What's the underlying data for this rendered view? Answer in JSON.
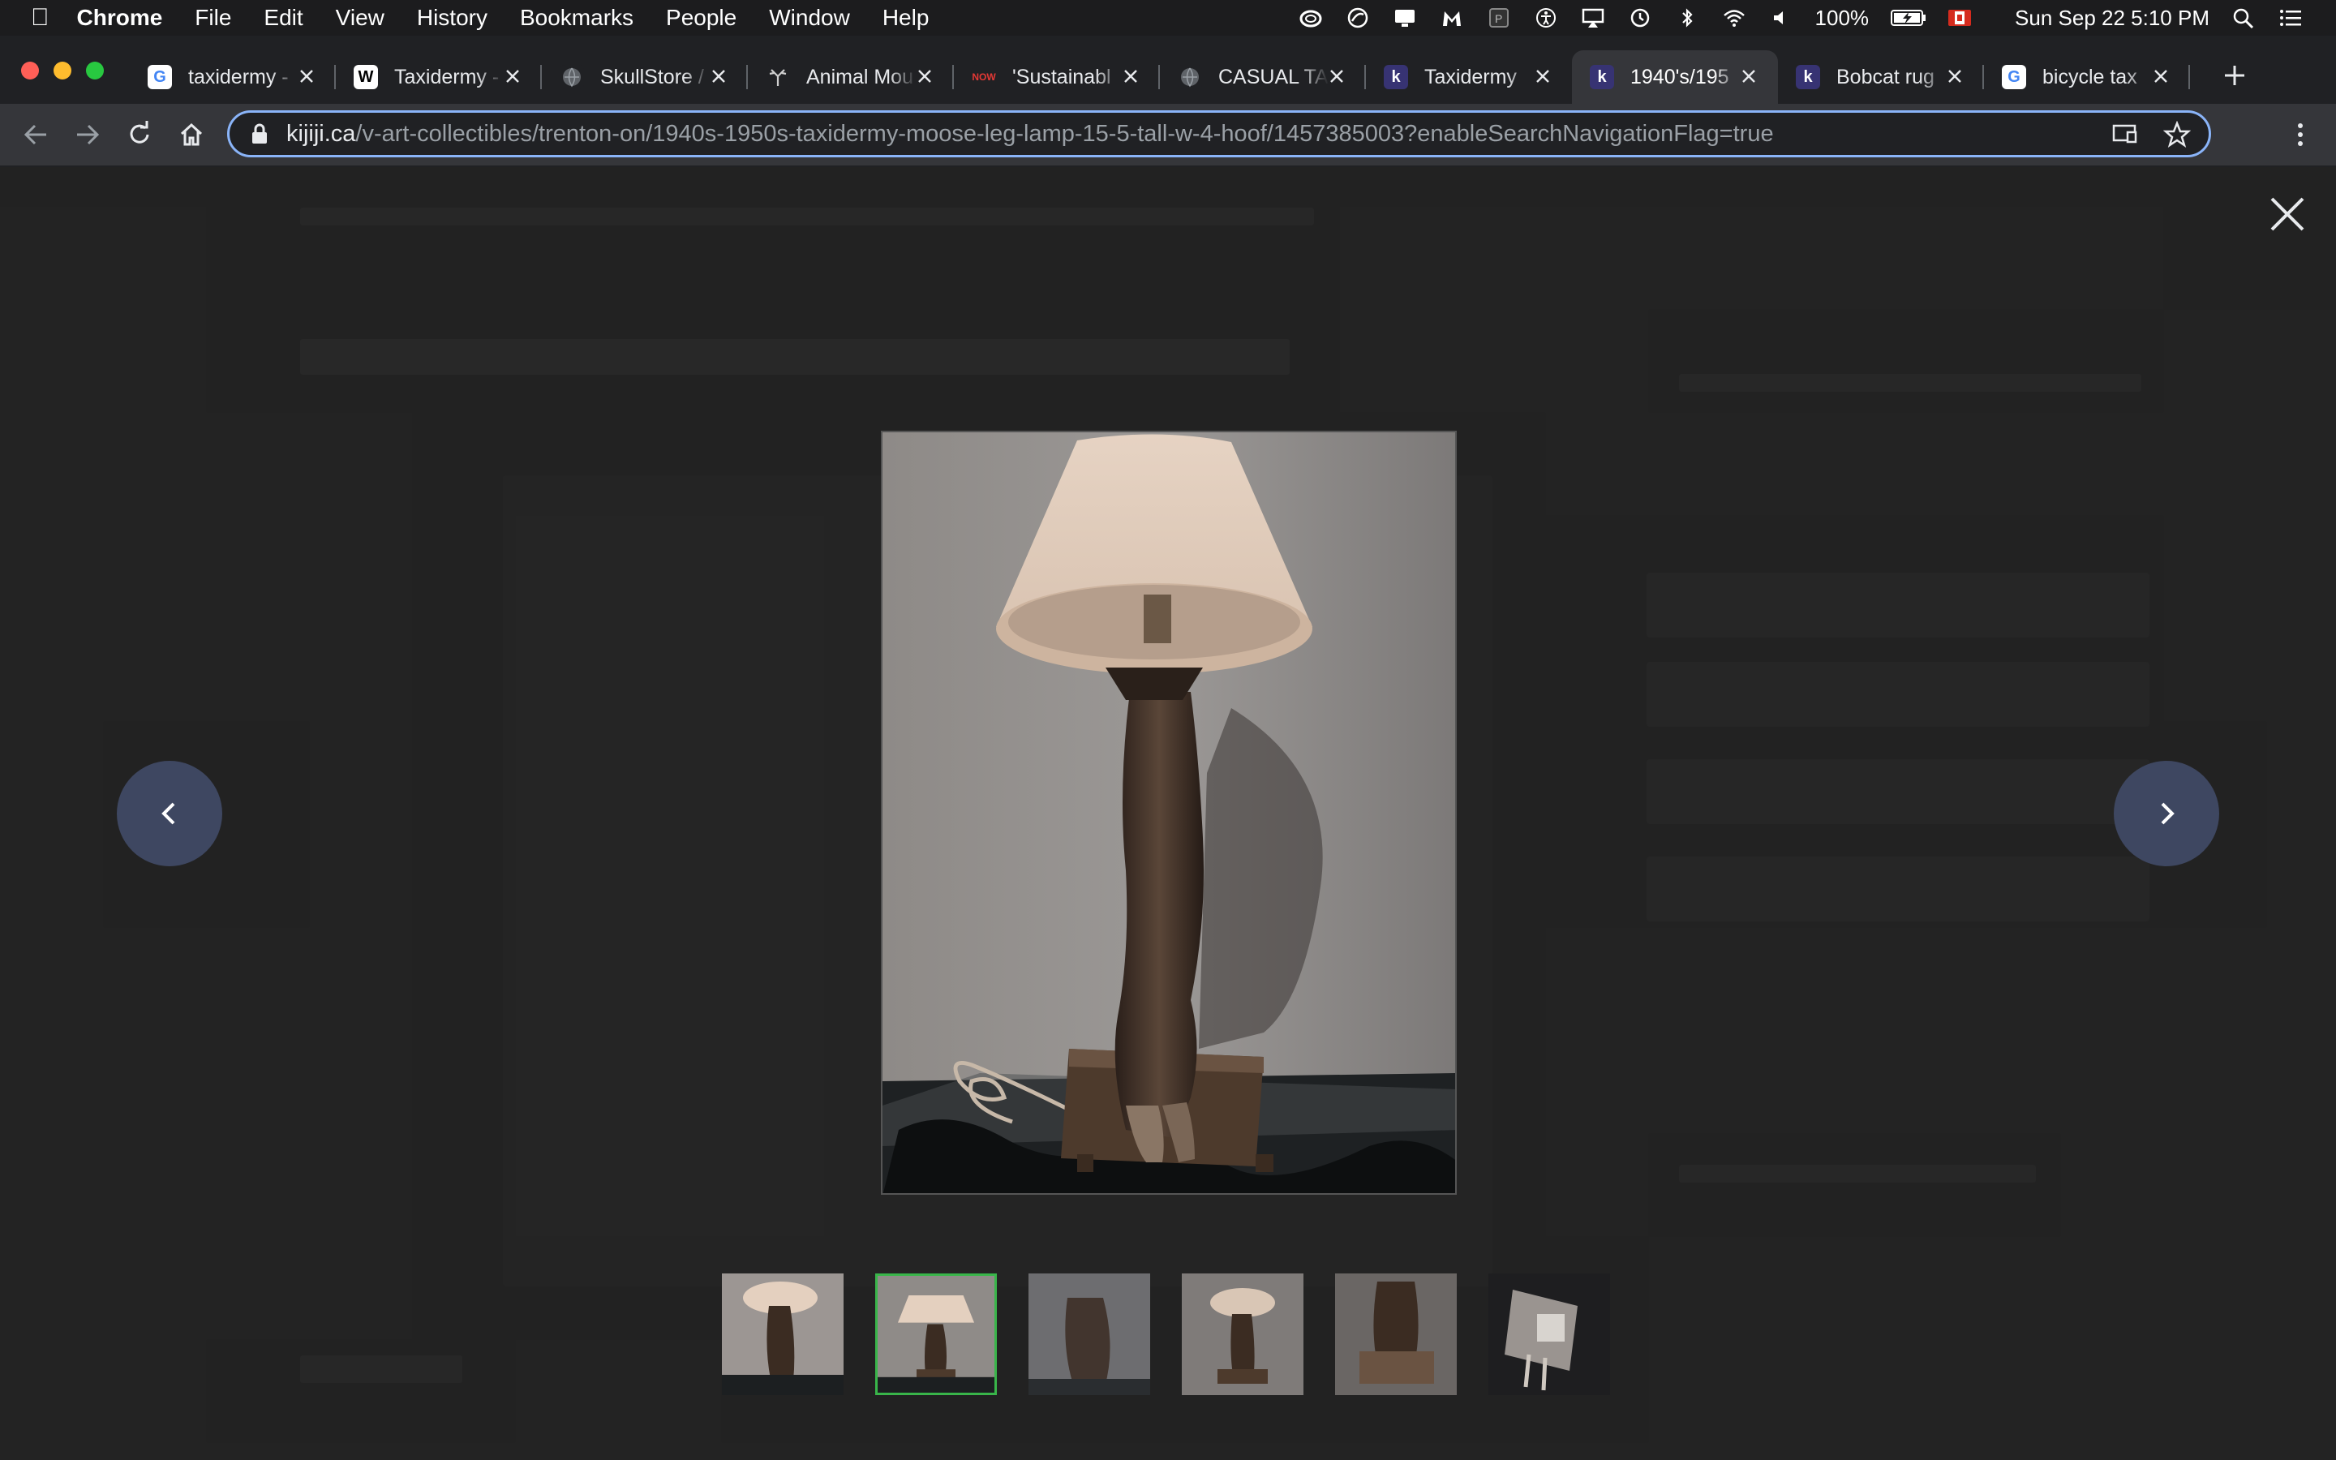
{
  "menubar": {
    "app": "Chrome",
    "items": [
      "File",
      "Edit",
      "View",
      "History",
      "Bookmarks",
      "People",
      "Window",
      "Help"
    ],
    "battery": "100%",
    "datetime": "Sun Sep 22  5:10 PM"
  },
  "tabs": [
    {
      "title": "taxidermy - ",
      "favicon": "G",
      "fav_bg": "#ffffff",
      "fav_fg": "#4285f4"
    },
    {
      "title": "Taxidermy - ",
      "favicon": "W",
      "fav_bg": "#ffffff",
      "fav_fg": "#000000"
    },
    {
      "title": "SkullStore / ",
      "favicon": "globe",
      "fav_bg": "#202124",
      "fav_fg": "#9aa0a6"
    },
    {
      "title": "Animal Mou",
      "favicon": "antler",
      "fav_bg": "#202124",
      "fav_fg": "#d0d0d0"
    },
    {
      "title": "'Sustainabl",
      "favicon": "NOW",
      "fav_bg": "#202124",
      "fav_fg": "#e53935"
    },
    {
      "title": "CASUAL TA",
      "favicon": "globe",
      "fav_bg": "#202124",
      "fav_fg": "#9aa0a6"
    },
    {
      "title": "Taxidermy",
      "favicon": "k",
      "fav_bg": "#373373",
      "fav_fg": "#ffffff"
    },
    {
      "title": "1940's/195",
      "favicon": "k",
      "fav_bg": "#373373",
      "fav_fg": "#ffffff",
      "active": true
    },
    {
      "title": "Bobcat rug",
      "favicon": "k",
      "fav_bg": "#373373",
      "fav_fg": "#ffffff"
    },
    {
      "title": "bicycle tax",
      "favicon": "G",
      "fav_bg": "#ffffff",
      "fav_fg": "#4285f4"
    }
  ],
  "toolbar": {
    "url_domain": "kijiji.ca",
    "url_path": "/v-art-collectibles/trenton-on/1940s-1950s-taxidermy-moose-leg-lamp-15-5-tall-w-4-hoof/1457385003?enableSearchNavigationFlag=true"
  },
  "lightbox": {
    "thumbnail_count": 6,
    "selected_thumbnail": 2
  },
  "colors": {
    "overlay_bg": "#2b2b2b",
    "nav_button": "#3e4761",
    "selected_thumb_border": "#39b54a",
    "omnibox_focus": "#8ab4f8"
  }
}
